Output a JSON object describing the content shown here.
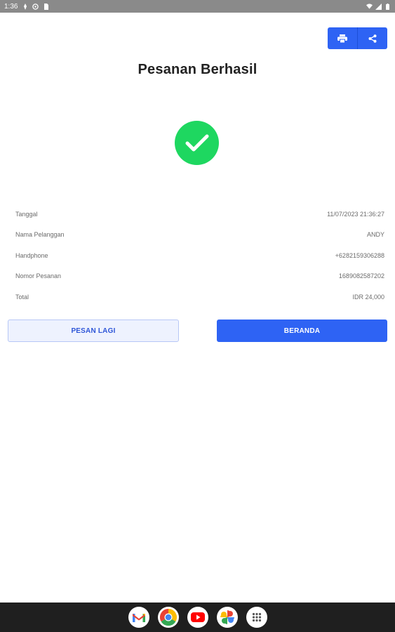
{
  "status_bar": {
    "time": "1:36",
    "icons": [
      "notification-icon",
      "vpn-icon",
      "sim-icon"
    ],
    "right_icons": [
      "wifi-icon",
      "signal-icon",
      "battery-icon"
    ]
  },
  "header": {
    "title": "Pesanan Berhasil",
    "actions": [
      {
        "name": "print-button",
        "icon": "print-icon"
      },
      {
        "name": "share-button",
        "icon": "share-icon"
      }
    ]
  },
  "status": {
    "icon": "check-circle-icon",
    "color": "#1ed760"
  },
  "details": [
    {
      "label": "Tanggal",
      "value": "11/07/2023 21:36:27"
    },
    {
      "label": "Nama Pelanggan",
      "value": "ANDY"
    },
    {
      "label": "Handphone",
      "value": "+6282159306288"
    },
    {
      "label": "Nomor Pesanan",
      "value": "1689082587202"
    },
    {
      "label": "Total",
      "value": "IDR 24,000"
    }
  ],
  "buttons": {
    "order_again": "PESAN LAGI",
    "home": "BERANDA"
  },
  "colors": {
    "accent": "#2e63f4",
    "success": "#1ed760",
    "status_bar": "#8a8a8a",
    "dock": "#1f1f1f"
  },
  "dock": {
    "apps": [
      "gmail-icon",
      "chrome-icon",
      "youtube-icon",
      "photos-icon",
      "app-drawer-icon"
    ]
  }
}
